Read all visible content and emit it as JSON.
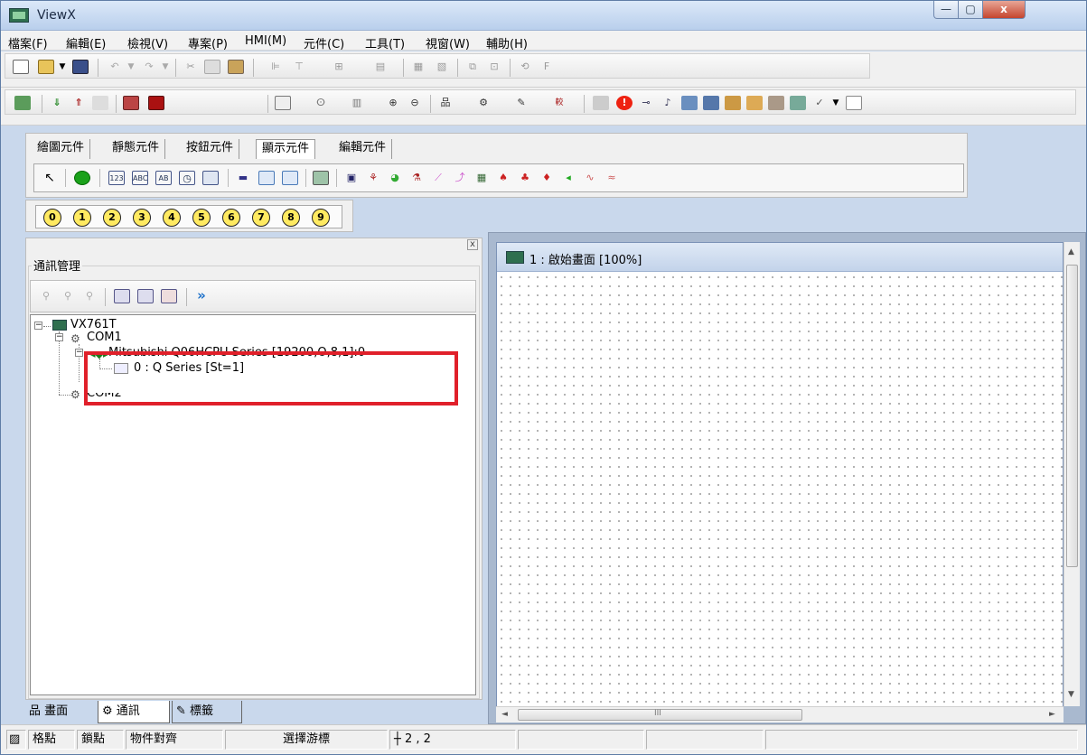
{
  "window": {
    "title": "ViewX",
    "min_glyph": "—",
    "max_glyph": "▢",
    "close_glyph": "x"
  },
  "menu": {
    "items": [
      "檔案(F)",
      "編輯(E)",
      "檢視(V)",
      "專案(P)",
      "HMI(M)",
      "元件(C)",
      "工具(T)",
      "視窗(W)",
      "輔助(H)"
    ]
  },
  "palette": {
    "tabs": [
      "繪圖元件",
      "靜態元件",
      "按鈕元件",
      "顯示元件",
      "編輯元件"
    ],
    "active_tab": "顯示元件"
  },
  "number_row": {
    "digits": [
      "0",
      "1",
      "2",
      "3",
      "4",
      "5",
      "6",
      "7",
      "8",
      "9"
    ]
  },
  "left_panel": {
    "close_glyph": "x",
    "group_title": "通訊管理",
    "tree": {
      "root": "VX761T",
      "com1": "COM1",
      "plc": "Mitsubishi Q06HCPU Series [19200,O,8,1]:0",
      "station": "0 : Q Series [St=1]",
      "com2": "COM2"
    },
    "bottom_tabs": [
      "畫面",
      "通訊",
      "標籤"
    ]
  },
  "document": {
    "title": "1 : 啟始畫面 [100%]"
  },
  "scroll": {
    "up": "▲",
    "down": "▼",
    "left": "◄",
    "right": "►",
    "grip": "III"
  },
  "status": {
    "cells": [
      "格點",
      "鎖點",
      "物件對齊",
      "選擇游標",
      "2 , 2"
    ]
  },
  "colors": {
    "highlight_border": "#e0202a",
    "titlebar": "#c9d8ec"
  }
}
